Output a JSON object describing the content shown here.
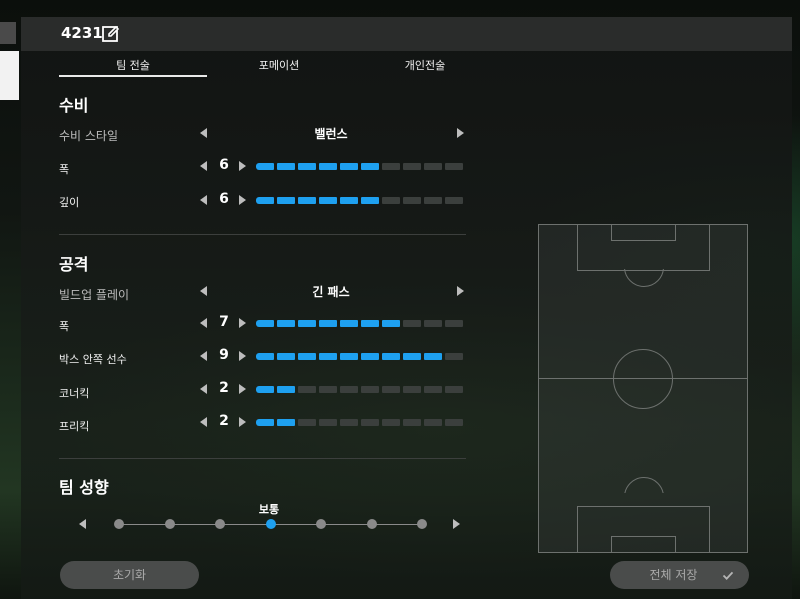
{
  "header": {
    "tactic_name": "4231"
  },
  "tabs": [
    {
      "label": "팀 전술",
      "active": true
    },
    {
      "label": "포메이션",
      "active": false
    },
    {
      "label": "개인전술",
      "active": false
    }
  ],
  "defense": {
    "title": "수비",
    "style_label": "수비 스타일",
    "style_value": "밸런스",
    "rows": [
      {
        "label": "폭",
        "value": 6
      },
      {
        "label": "깊이",
        "value": 6
      }
    ]
  },
  "attack": {
    "title": "공격",
    "buildup_label": "빌드업 플레이",
    "buildup_value": "긴 패스",
    "rows": [
      {
        "label": "폭",
        "value": 7
      },
      {
        "label": "박스 안쪽 선수",
        "value": 9
      },
      {
        "label": "코너킥",
        "value": 2
      },
      {
        "label": "프리킥",
        "value": 2
      }
    ]
  },
  "bar_max": 10,
  "team_tendency": {
    "title": "팀 성향",
    "current_label": "보통",
    "steps": 7,
    "selected_index": 3
  },
  "buttons": {
    "reset": "초기화",
    "save_all": "전체 저장"
  },
  "colors": {
    "accent": "#1ea0f0",
    "bar_off": "#3b3f3d"
  }
}
